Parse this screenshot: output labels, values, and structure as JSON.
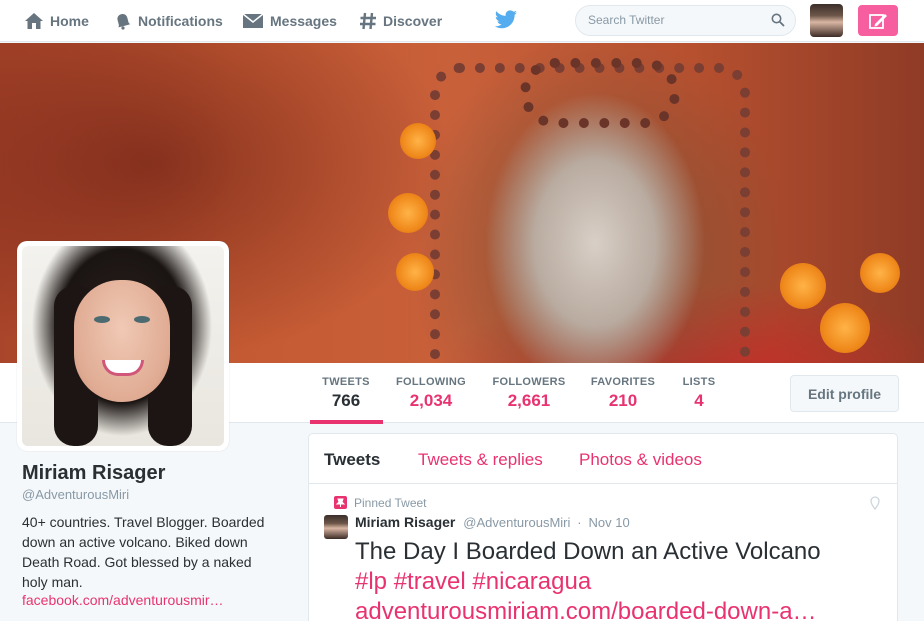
{
  "nav": {
    "home": "Home",
    "notifications": "Notifications",
    "messages": "Messages",
    "discover": "Discover",
    "search_placeholder": "Search Twitter"
  },
  "colors": {
    "accent": "#e8336f",
    "tweet_button": "#f75ea0",
    "twitter_blue": "#55acee"
  },
  "profile": {
    "name": "Miriam Risager",
    "handle": "@AdventurousMiri",
    "bio_lines": [
      "40+ countries. Travel Blogger. Boarded",
      "down an active volcano. Biked down",
      "Death Road. Got blessed by a naked",
      "holy man."
    ],
    "link": "facebook.com/adventurousmir…"
  },
  "stats": {
    "tweets": {
      "label": "TWEETS",
      "value": "766"
    },
    "following": {
      "label": "FOLLOWING",
      "value": "2,034"
    },
    "followers": {
      "label": "FOLLOWERS",
      "value": "2,661"
    },
    "favorites": {
      "label": "FAVORITES",
      "value": "210"
    },
    "lists": {
      "label": "LISTS",
      "value": "4"
    }
  },
  "edit_profile": "Edit profile",
  "timeline": {
    "tabs": [
      "Tweets",
      "Tweets & replies",
      "Photos & videos"
    ],
    "pinned_label": "Pinned Tweet",
    "tweet": {
      "name": "Miriam Risager",
      "handle": "@AdventurousMiri",
      "separator": "·",
      "date": "Nov 10",
      "title": "The Day I Boarded Down an Active Volcano",
      "hashtags": [
        "#lp",
        "#travel",
        "#nicaragua"
      ],
      "link": "adventurousmiriam.com/boarded-down-a…"
    }
  }
}
